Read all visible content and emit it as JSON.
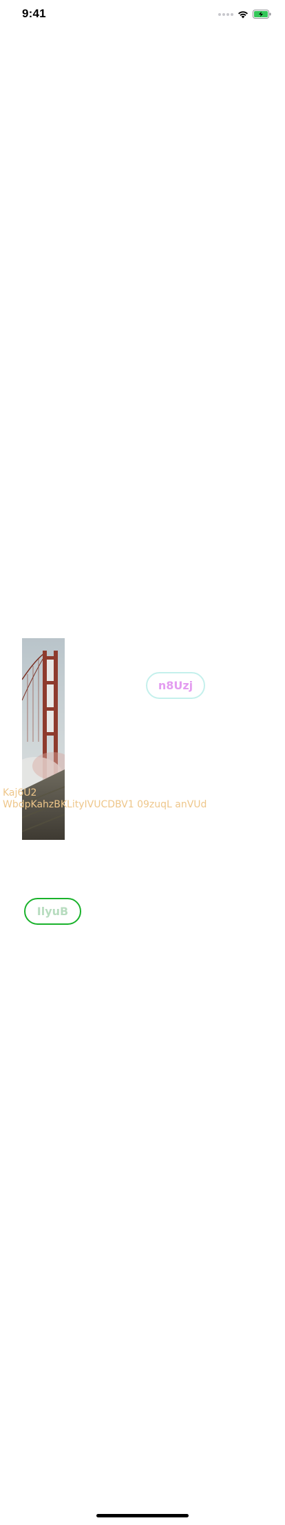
{
  "status_bar": {
    "time": "9:41",
    "icons": [
      "signal-dots-icon",
      "wifi-icon",
      "battery-charging-icon"
    ],
    "battery_color": "#34c759"
  },
  "image": {
    "subject": "bridge-photo"
  },
  "buttons": {
    "n8uzj": {
      "label": "n8Uzj",
      "border_color": "#c4f0ec",
      "text_color": "#e39cf0"
    },
    "ilyub": {
      "label": "IlyuB",
      "border_color": "#19b22b",
      "text_color": "#b7dcbf"
    }
  },
  "text_block": {
    "value": "Kaj6U2\nWbdpKahzBKLityIVUCDBV1 09zuqL anVUd",
    "color": "#eec68a"
  }
}
